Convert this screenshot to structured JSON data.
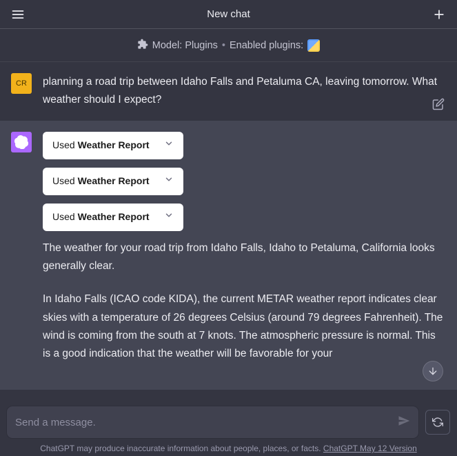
{
  "header": {
    "title": "New chat"
  },
  "subheader": {
    "model_label": "Model: Plugins",
    "enabled_label": "Enabled plugins:"
  },
  "user_message": {
    "avatar_initials": "CR",
    "text": "planning a road trip between Idaho Falls and Petaluma CA, leaving tomorrow. What weather should I expect?"
  },
  "plugin_calls": [
    {
      "used": "Used ",
      "name": "Weather Report"
    },
    {
      "used": "Used ",
      "name": "Weather Report"
    },
    {
      "used": "Used ",
      "name": "Weather Report"
    }
  ],
  "assistant_message": {
    "p1": "The weather for your road trip from Idaho Falls, Idaho to Petaluma, California looks generally clear.",
    "p2": "In Idaho Falls (ICAO code KIDA), the current METAR weather report indicates clear skies with a temperature of 26 degrees Celsius (around 79 degrees Fahrenheit). The wind is coming from the south at 7 knots. The atmospheric pressure is normal. This is a good indication that the weather will be favorable for your"
  },
  "input": {
    "placeholder": "Send a message."
  },
  "footer": {
    "disclaimer_prefix": "ChatGPT may produce inaccurate information about people, places, or facts. ",
    "version_link": "ChatGPT May 12 Version"
  }
}
